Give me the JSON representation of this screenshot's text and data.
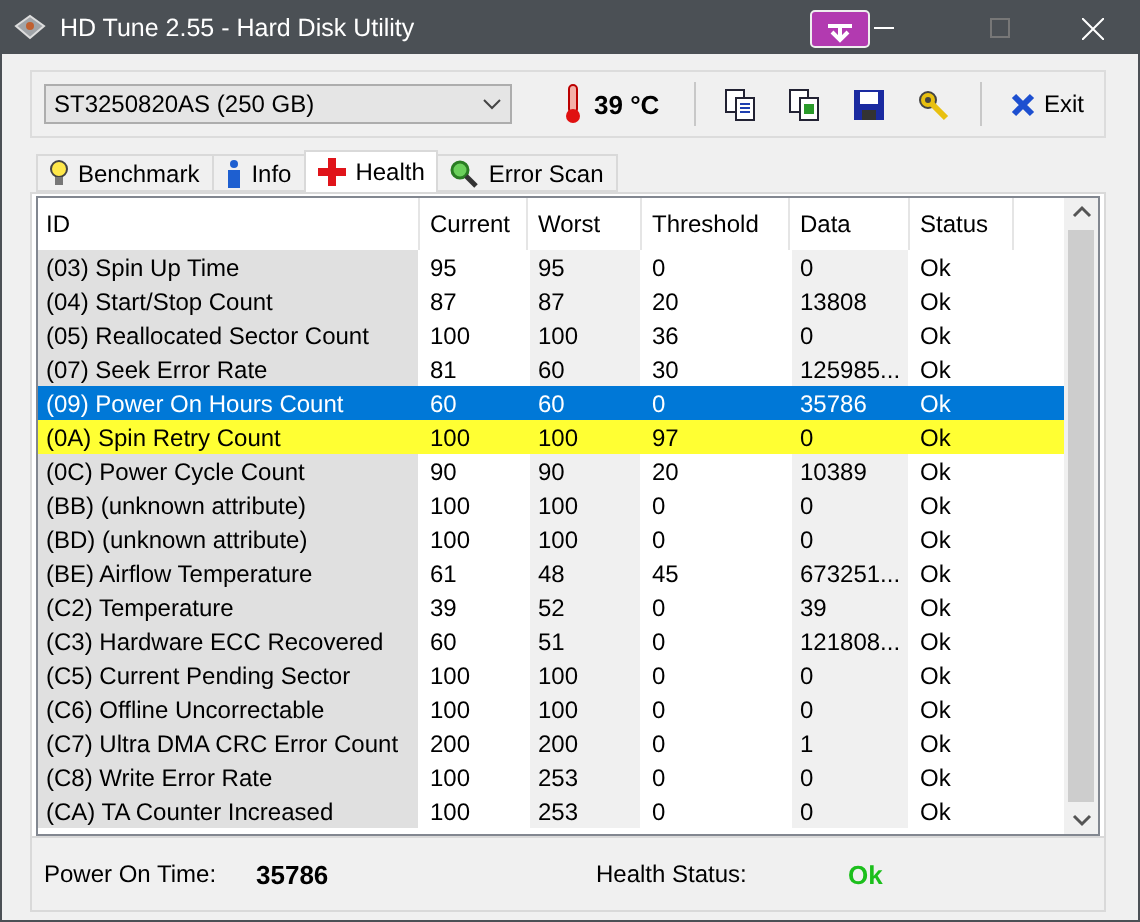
{
  "window": {
    "title": "HD Tune 2.55 - Hard Disk Utility"
  },
  "toolbar": {
    "drive": "ST3250820AS (250 GB)",
    "temperature": "39 °C",
    "exit": "Exit"
  },
  "tabs": [
    {
      "label": "Benchmark",
      "selected": false
    },
    {
      "label": "Info",
      "selected": false
    },
    {
      "label": "Health",
      "selected": true
    },
    {
      "label": "Error Scan",
      "selected": false
    }
  ],
  "table": {
    "columns": [
      "ID",
      "Current",
      "Worst",
      "Threshold",
      "Data",
      "Status"
    ],
    "rows": [
      {
        "cells": [
          "(03) Spin Up Time",
          "95",
          "95",
          "0",
          "0",
          "Ok"
        ],
        "selected": false,
        "warning": false
      },
      {
        "cells": [
          "(04) Start/Stop Count",
          "87",
          "87",
          "20",
          "13808",
          "Ok"
        ],
        "selected": false,
        "warning": false
      },
      {
        "cells": [
          "(05) Reallocated Sector Count",
          "100",
          "100",
          "36",
          "0",
          "Ok"
        ],
        "selected": false,
        "warning": false
      },
      {
        "cells": [
          "(07) Seek Error Rate",
          "81",
          "60",
          "30",
          "125985...",
          "Ok"
        ],
        "selected": false,
        "warning": false
      },
      {
        "cells": [
          "(09) Power On Hours Count",
          "60",
          "60",
          "0",
          "35786",
          "Ok"
        ],
        "selected": true,
        "warning": false
      },
      {
        "cells": [
          "(0A) Spin Retry Count",
          "100",
          "100",
          "97",
          "0",
          "Ok"
        ],
        "selected": false,
        "warning": true
      },
      {
        "cells": [
          "(0C) Power Cycle Count",
          "90",
          "90",
          "20",
          "10389",
          "Ok"
        ],
        "selected": false,
        "warning": false
      },
      {
        "cells": [
          "(BB) (unknown attribute)",
          "100",
          "100",
          "0",
          "0",
          "Ok"
        ],
        "selected": false,
        "warning": false
      },
      {
        "cells": [
          "(BD) (unknown attribute)",
          "100",
          "100",
          "0",
          "0",
          "Ok"
        ],
        "selected": false,
        "warning": false
      },
      {
        "cells": [
          "(BE) Airflow Temperature",
          "61",
          "48",
          "45",
          "673251...",
          "Ok"
        ],
        "selected": false,
        "warning": false
      },
      {
        "cells": [
          "(C2) Temperature",
          "39",
          "52",
          "0",
          "39",
          "Ok"
        ],
        "selected": false,
        "warning": false
      },
      {
        "cells": [
          "(C3) Hardware ECC Recovered",
          "60",
          "51",
          "0",
          "121808...",
          "Ok"
        ],
        "selected": false,
        "warning": false
      },
      {
        "cells": [
          "(C5) Current Pending Sector",
          "100",
          "100",
          "0",
          "0",
          "Ok"
        ],
        "selected": false,
        "warning": false
      },
      {
        "cells": [
          "(C6) Offline Uncorrectable",
          "100",
          "100",
          "0",
          "0",
          "Ok"
        ],
        "selected": false,
        "warning": false
      },
      {
        "cells": [
          "(C7) Ultra DMA CRC Error Count",
          "200",
          "200",
          "0",
          "1",
          "Ok"
        ],
        "selected": false,
        "warning": false
      },
      {
        "cells": [
          "(C8) Write Error Rate",
          "100",
          "253",
          "0",
          "0",
          "Ok"
        ],
        "selected": false,
        "warning": false
      },
      {
        "cells": [
          "(CA) TA Counter Increased",
          "100",
          "253",
          "0",
          "0",
          "Ok"
        ],
        "selected": false,
        "warning": false
      }
    ]
  },
  "status": {
    "power_on_label": "Power On Time:",
    "power_on_value": "35786",
    "health_label": "Health Status:",
    "health_value": "Ok"
  }
}
